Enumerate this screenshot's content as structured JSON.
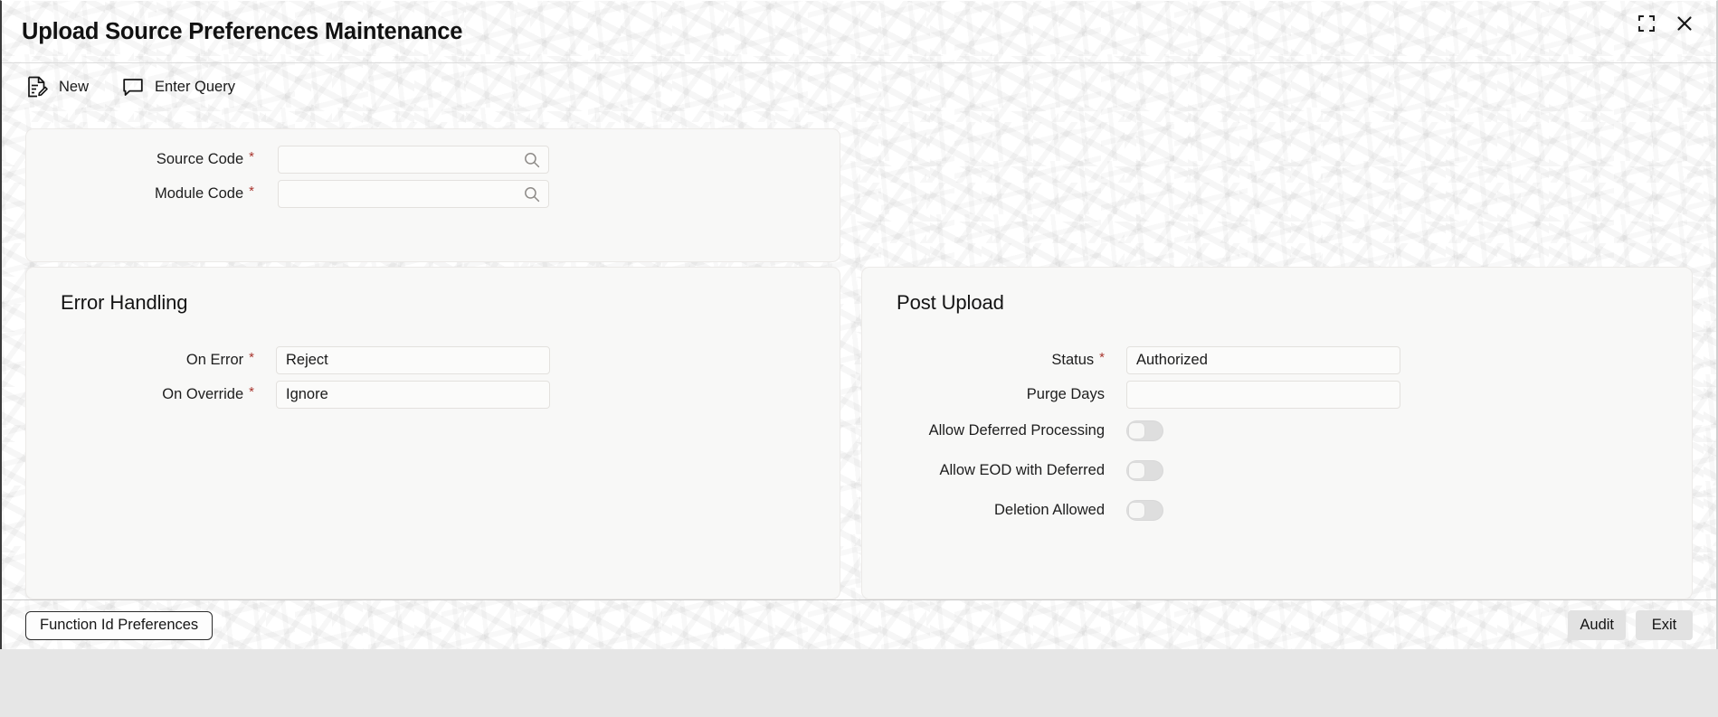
{
  "window": {
    "title": "Upload Source Preferences Maintenance",
    "controls": [
      {
        "name": "collapse-icon",
        "icon": "collapse-corners-icon"
      },
      {
        "name": "close-icon",
        "icon": "close-x-icon"
      }
    ]
  },
  "toolbar": {
    "items": [
      {
        "label": "New",
        "icon": "new-document-edit-icon"
      },
      {
        "label": "Enter Query",
        "icon": "speech-bubble-icon"
      }
    ]
  },
  "header_panel": {
    "fields": [
      {
        "label": "Source Code",
        "required": true,
        "value": "",
        "lov": true,
        "icon": "search-icon"
      },
      {
        "label": "Module Code",
        "required": true,
        "value": "",
        "lov": true,
        "icon": "search-icon"
      }
    ]
  },
  "error_handling": {
    "title": "Error Handling",
    "fields": [
      {
        "label": "On Error",
        "required": true,
        "value": "Reject"
      },
      {
        "label": "On Override",
        "required": true,
        "value": "Ignore"
      }
    ]
  },
  "post_upload": {
    "title": "Post Upload",
    "fields": [
      {
        "label": "Status",
        "required": true,
        "value": "Authorized"
      },
      {
        "label": "Purge Days",
        "required": false,
        "value": ""
      }
    ],
    "toggles": [
      {
        "label": "Allow Deferred Processing",
        "state": "off"
      },
      {
        "label": "Allow EOD with Deferred",
        "state": "off"
      },
      {
        "label": "Deletion Allowed",
        "state": "off"
      }
    ]
  },
  "footer": {
    "primary_button": "Function Id Preferences",
    "right_buttons": [
      "Audit",
      "Exit"
    ]
  },
  "colors": {
    "required_asterisk": "#a8352e",
    "panel_background": "#f8f8f7",
    "page_background": "#ffffff",
    "outer_strip": "#e6e6e6",
    "text": "#1c1c1c",
    "toggle_track_off": "#dedede"
  }
}
